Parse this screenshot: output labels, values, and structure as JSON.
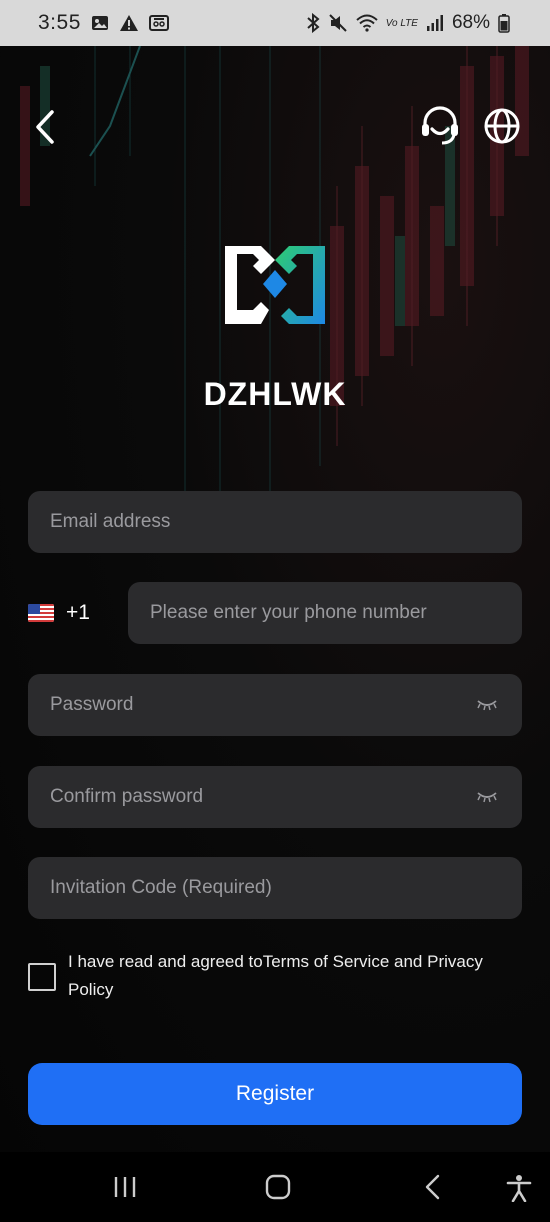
{
  "status_bar": {
    "time": "3:55",
    "battery": "68%",
    "network": "Vo LTE",
    "icons_left": [
      "image-icon",
      "warning-icon",
      "cast-icon"
    ],
    "icons_right": [
      "bluetooth-icon",
      "mute-icon",
      "wifi-icon",
      "signal-icon",
      "battery-icon"
    ]
  },
  "header": {
    "back_icon": "chevron-left-icon",
    "support_icon": "headset-icon",
    "language_icon": "globe-icon"
  },
  "brand": {
    "name": "DZHLWK",
    "logo_colors": [
      "#ffffff",
      "#2ecc71",
      "#1e88e5"
    ]
  },
  "form": {
    "email_placeholder": "Email address",
    "country_code": "+1",
    "country_flag": "us-flag-icon",
    "phone_placeholder": "Please enter your phone number",
    "password_placeholder": "Password",
    "confirm_password_placeholder": "Confirm password",
    "invitation_placeholder": "Invitation Code (Required)",
    "terms_text": "I have read and agreed toTerms of Service and Privacy Policy",
    "terms_checked": false,
    "register_label": "Register"
  },
  "colors": {
    "accent": "#1f6ff5",
    "field_bg": "#2b2b2d",
    "background": "#050505"
  },
  "nav_bar": {
    "items": [
      "recent-apps-icon",
      "home-icon",
      "back-icon",
      "accessibility-icon"
    ]
  }
}
